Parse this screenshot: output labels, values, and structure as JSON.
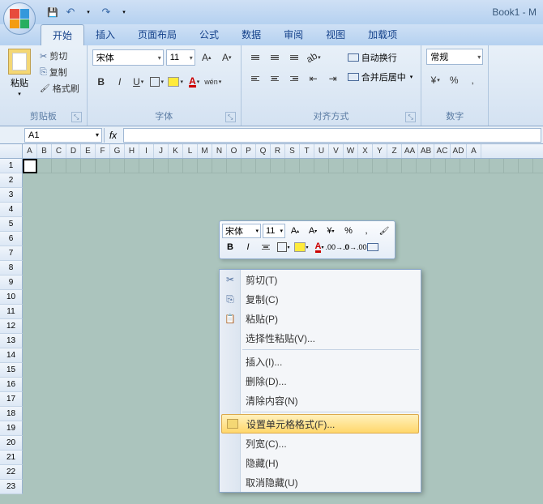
{
  "title": "Book1 - M",
  "tabs": [
    "开始",
    "插入",
    "页面布局",
    "公式",
    "数据",
    "审阅",
    "视图",
    "加载项"
  ],
  "clipboard": {
    "paste": "粘贴",
    "cut": "剪切",
    "copy": "复制",
    "format_painter": "格式刷",
    "group": "剪贴板"
  },
  "font": {
    "family": "宋体",
    "size": "11",
    "group": "字体"
  },
  "align": {
    "wrap": "自动换行",
    "merge": "合并后居中",
    "group": "对齐方式"
  },
  "number": {
    "format": "常规",
    "group": "数字"
  },
  "name_box": "A1",
  "cols": [
    "A",
    "B",
    "C",
    "D",
    "E",
    "F",
    "G",
    "H",
    "I",
    "J",
    "K",
    "L",
    "M",
    "N",
    "O",
    "P",
    "Q",
    "R",
    "S",
    "T",
    "U",
    "V",
    "W",
    "X",
    "Y",
    "Z",
    "AA",
    "AB",
    "AC",
    "AD",
    "A"
  ],
  "row_count": 23,
  "mini": {
    "font": "宋体",
    "size": "11",
    "percent": "%",
    "comma": ",",
    "bold": "B",
    "italic": "I"
  },
  "ctx": {
    "cut": "剪切(T)",
    "copy": "复制(C)",
    "paste": "粘贴(P)",
    "paste_special": "选择性粘贴(V)...",
    "insert": "插入(I)...",
    "delete": "删除(D)...",
    "clear": "清除内容(N)",
    "format_cells": "设置单元格格式(F)...",
    "col_width": "列宽(C)...",
    "hide": "隐藏(H)",
    "unhide": "取消隐藏(U)"
  }
}
